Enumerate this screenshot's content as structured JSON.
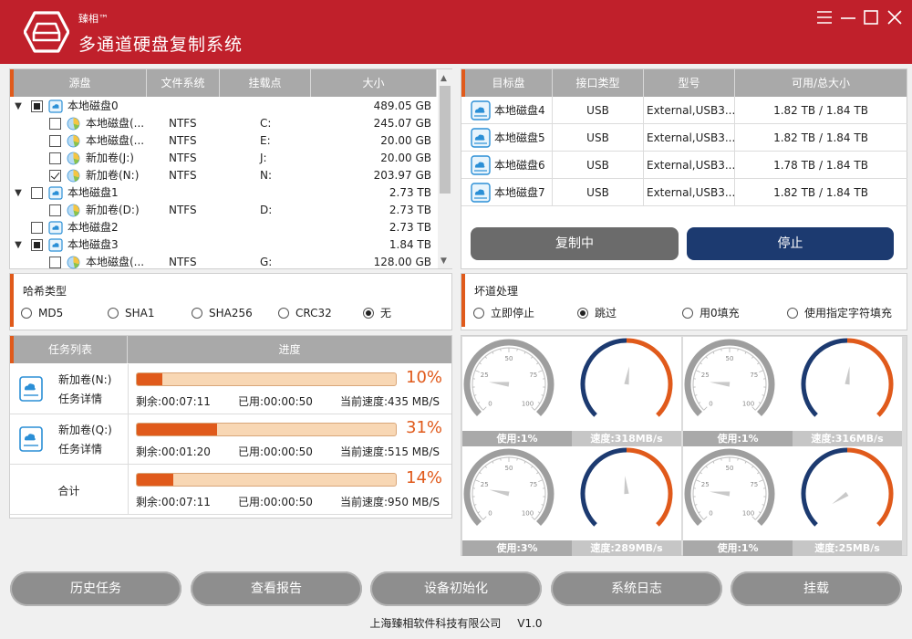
{
  "app": {
    "brand": "臻相™",
    "title": "多通道硬盘复制系统"
  },
  "source": {
    "headers": [
      "源盘",
      "文件系统",
      "挂载点",
      "大小"
    ],
    "rows": [
      {
        "level": 0,
        "expander": "▼",
        "check": "part",
        "icon": "disk",
        "name": "本地磁盘0",
        "fs": "",
        "mount": "",
        "size": "489.05 GB"
      },
      {
        "level": 1,
        "expander": "",
        "check": "none",
        "icon": "pie",
        "name": "本地磁盘(...",
        "fs": "NTFS",
        "mount": "C:",
        "size": "245.07 GB"
      },
      {
        "level": 1,
        "expander": "",
        "check": "none",
        "icon": "pie",
        "name": "本地磁盘(...",
        "fs": "NTFS",
        "mount": "E:",
        "size": "20.00 GB"
      },
      {
        "level": 1,
        "expander": "",
        "check": "none",
        "icon": "pie",
        "name": "新加卷(J:)",
        "fs": "NTFS",
        "mount": "J:",
        "size": "20.00 GB"
      },
      {
        "level": 1,
        "expander": "",
        "check": "checked",
        "icon": "pie",
        "name": "新加卷(N:)",
        "fs": "NTFS",
        "mount": "N:",
        "size": "203.97 GB"
      },
      {
        "level": 0,
        "expander": "▼",
        "check": "none",
        "icon": "disk",
        "name": "本地磁盘1",
        "fs": "",
        "mount": "",
        "size": "2.73 TB"
      },
      {
        "level": 1,
        "expander": "",
        "check": "none",
        "icon": "pie",
        "name": "新加卷(D:)",
        "fs": "NTFS",
        "mount": "D:",
        "size": "2.73 TB"
      },
      {
        "level": 0,
        "expander": "",
        "check": "none",
        "icon": "disk",
        "name": "本地磁盘2",
        "fs": "",
        "mount": "",
        "size": "2.73 TB"
      },
      {
        "level": 0,
        "expander": "▼",
        "check": "part",
        "icon": "disk",
        "name": "本地磁盘3",
        "fs": "",
        "mount": "",
        "size": "1.84 TB"
      },
      {
        "level": 1,
        "expander": "",
        "check": "none",
        "icon": "pie",
        "name": "本地磁盘(...",
        "fs": "NTFS",
        "mount": "G:",
        "size": "128.00 GB"
      }
    ]
  },
  "target": {
    "headers": [
      "目标盘",
      "接口类型",
      "型号",
      "可用/总大小"
    ],
    "rows": [
      {
        "name": "本地磁盘4",
        "iface": "USB",
        "model": "External,USB3...",
        "avail": "1.82 TB / 1.84 TB"
      },
      {
        "name": "本地磁盘5",
        "iface": "USB",
        "model": "External,USB3...",
        "avail": "1.82 TB / 1.84 TB"
      },
      {
        "name": "本地磁盘6",
        "iface": "USB",
        "model": "External,USB3...",
        "avail": "1.78 TB / 1.84 TB"
      },
      {
        "name": "本地磁盘7",
        "iface": "USB",
        "model": "External,USB3...",
        "avail": "1.82 TB / 1.84 TB"
      }
    ],
    "copy_button": "复制中",
    "stop_button": "停止"
  },
  "hash": {
    "title": "哈希类型",
    "options": [
      "MD5",
      "SHA1",
      "SHA256",
      "CRC32",
      "无"
    ],
    "selected": "无"
  },
  "bad_sector": {
    "title": "坏道处理",
    "options": [
      "立即停止",
      "跳过",
      "用0填充",
      "使用指定字符填充"
    ],
    "selected": "跳过"
  },
  "tasks": {
    "headers": [
      "任务列表",
      "进度"
    ],
    "detail_label": "任务详情",
    "items": [
      {
        "name": "新加卷(N:)",
        "progress": 10,
        "pct": "10%",
        "remaining": "剩余:00:07:11",
        "used": "已用:00:00:50",
        "speed": "当前速度:435 MB/S"
      },
      {
        "name": "新加卷(Q:)",
        "progress": 31,
        "pct": "31%",
        "remaining": "剩余:00:01:20",
        "used": "已用:00:00:50",
        "speed": "当前速度:515 MB/S"
      }
    ],
    "total": {
      "name": "合计",
      "progress": 14,
      "pct": "14%",
      "remaining": "剩余:00:07:11",
      "used": "已用:00:00:50",
      "speed": "当前速度:950 MB/S"
    }
  },
  "gauges": {
    "ticks": [
      "0",
      "25",
      "50",
      "75",
      "100"
    ],
    "items": [
      {
        "usage": 1,
        "usage_label": "使用:1%",
        "speed": 318,
        "speed_label": "速度:318MB/s"
      },
      {
        "usage": 1,
        "usage_label": "使用:1%",
        "speed": 316,
        "speed_label": "速度:316MB/s"
      },
      {
        "usage": 3,
        "usage_label": "使用:3%",
        "speed": 289,
        "speed_label": "速度:289MB/s"
      },
      {
        "usage": 1,
        "usage_label": "使用:1%",
        "speed": 25,
        "speed_label": "速度:25MB/s"
      }
    ]
  },
  "bottom_buttons": [
    "历史任务",
    "查看报告",
    "设备初始化",
    "系统日志",
    "挂载"
  ],
  "footer": {
    "company": "上海臻相软件科技有限公司",
    "version": "V1.0"
  },
  "colors": {
    "brand_red": "#c0202b",
    "accent_orange": "#e05a1b",
    "navy": "#1c3a70"
  }
}
